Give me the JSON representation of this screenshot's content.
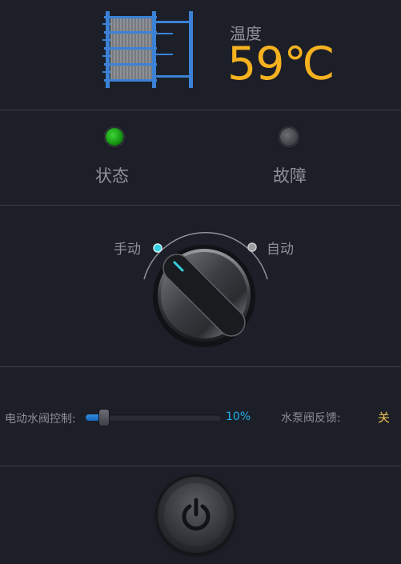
{
  "temperature": {
    "label": "温度",
    "value": "59℃"
  },
  "indicators": {
    "status": {
      "label": "状态",
      "state": "on",
      "color": "#2bc020"
    },
    "fault": {
      "label": "故障",
      "state": "off",
      "color": "#55575c"
    }
  },
  "mode": {
    "manual_label": "手动",
    "auto_label": "自动",
    "selected": "manual",
    "accent": "#33d2e0"
  },
  "valve": {
    "label": "电动水阀控制:",
    "value": 0.1,
    "value_text": "10%"
  },
  "pump": {
    "label": "水泵阀反馈:",
    "value": "关"
  },
  "power": {
    "icon": "power-icon"
  },
  "colors": {
    "temperature": "#f5b21f",
    "percent": "#1eb0ea",
    "pump_value": "#f0c150",
    "icon_blue": "#3b82d6"
  }
}
